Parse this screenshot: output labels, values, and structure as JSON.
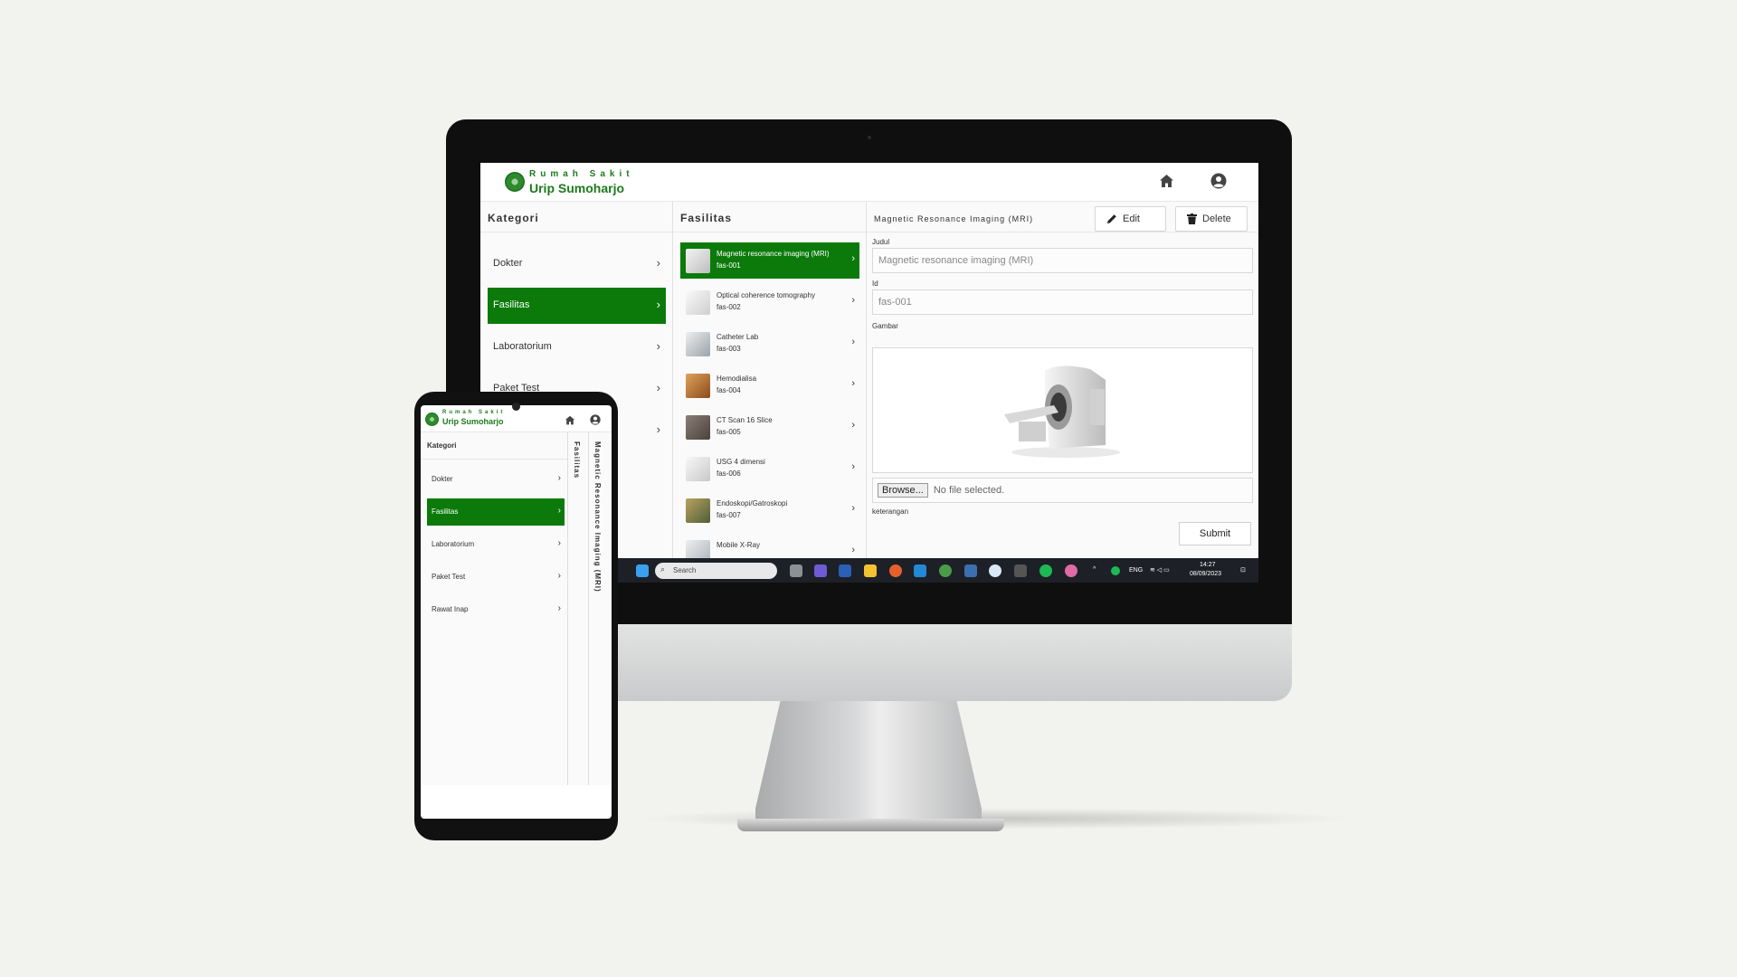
{
  "logo": {
    "line1": "Rumah Sakit",
    "line2": "Urip Sumoharjo"
  },
  "colors": {
    "brand_green": "#0b7a0b"
  },
  "header_icons": {
    "home": "home-icon",
    "profile": "user-circle-icon"
  },
  "kategori": {
    "title": "Kategori",
    "items": [
      {
        "label": "Dokter"
      },
      {
        "label": "Fasilitas",
        "active": true
      },
      {
        "label": "Laboratorium"
      },
      {
        "label": "Paket Test"
      },
      {
        "label": "Rawat Inap"
      }
    ]
  },
  "fasilitas": {
    "title": "Fasilitas",
    "items": [
      {
        "title": "Magnetic resonance imaging (MRI)",
        "id": "fas-001",
        "active": true
      },
      {
        "title": "Optical coherence tomography",
        "id": "fas-002"
      },
      {
        "title": "Catheter Lab",
        "id": "fas-003"
      },
      {
        "title": "Hemodialisa",
        "id": "fas-004"
      },
      {
        "title": "CT Scan 16 Slice",
        "id": "fas-005"
      },
      {
        "title": "USG 4 dimensi",
        "id": "fas-006"
      },
      {
        "title": "Endoskopi/Gatroskopi",
        "id": "fas-007"
      },
      {
        "title": "Mobile X-Ray",
        "id": ""
      }
    ]
  },
  "detail": {
    "title": "Magnetic Resonance Imaging (MRI)",
    "edit_label": "Edit",
    "delete_label": "Delete",
    "judul_label": "Judul",
    "judul_value": "Magnetic resonance imaging (MRI)",
    "id_label": "Id",
    "id_value": "fas-001",
    "gambar_label": "Gambar",
    "browse_label": "Browse...",
    "file_status": "No file selected.",
    "keterangan_label": "keterangan",
    "submit_label": "Submit"
  },
  "taskbar": {
    "search_placeholder": "Search",
    "language": "ENG",
    "time": "14:27",
    "date": "08/09/2023"
  },
  "phone": {
    "kategori_title": "Kategori",
    "vertical_fasilitas": "Fasilitas",
    "vertical_detail": "Magnetic Resonance Imaging (MRI)"
  }
}
